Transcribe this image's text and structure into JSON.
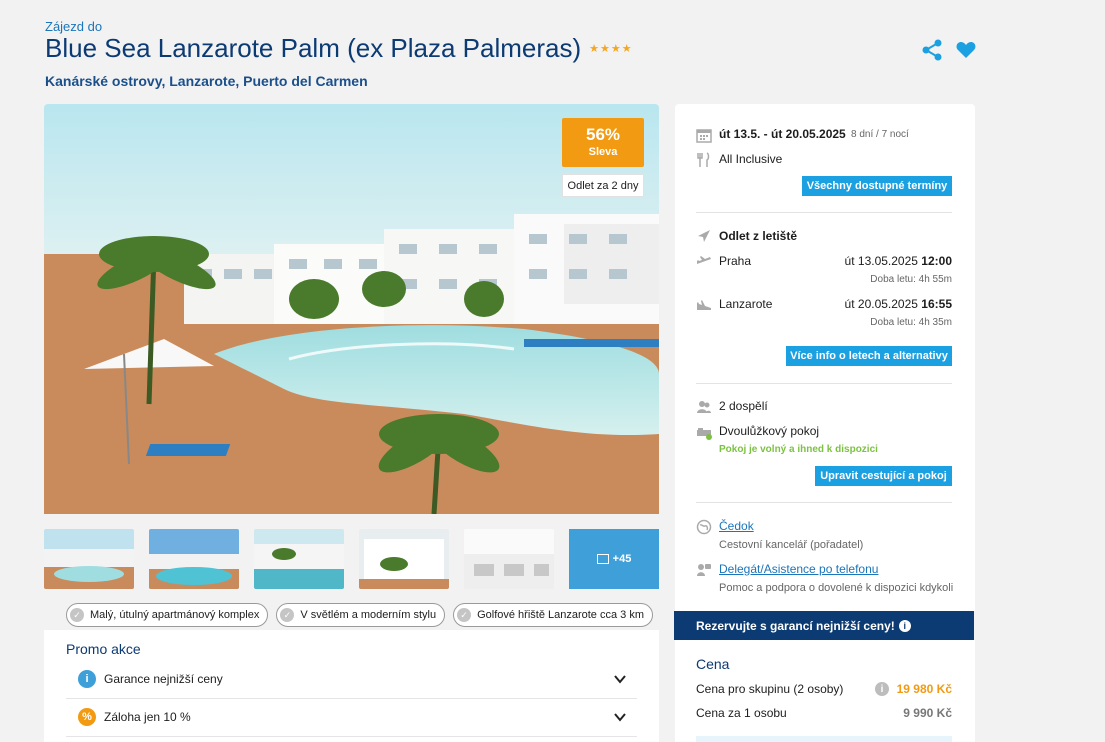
{
  "header": {
    "subtitle": "Zájezd do",
    "title": "Blue Sea Lanzarote Palm (ex Plaza Palmeras)",
    "stars": "★★★★",
    "location": "Kanárské ostrovy, Lanzarote, Puerto del Carmen"
  },
  "badges": {
    "discount_pct": "56%",
    "discount_label": "Sleva",
    "departure": "Odlet za 2 dny"
  },
  "gallery": {
    "more_label": "+45"
  },
  "features": [
    "Malý, útulný apartmánový komplex",
    "V světlém a moderním stylu",
    "Golfové hřiště Lanzarote cca 3 km"
  ],
  "promo": {
    "title": "Promo akce",
    "items": [
      {
        "label": "Garance nejnižší ceny",
        "icon": "info-icon",
        "color": "#3f9fd8"
      },
      {
        "label": "Záloha jen 10 %",
        "icon": "percent-icon",
        "color": "#f29a12"
      }
    ]
  },
  "sidebar": {
    "dates": "út 13.5. - út 20.05.2025",
    "duration": "8 dní / 7 nocí",
    "board": "All Inclusive",
    "all_dates_btn": "Všechny dostupné termíny",
    "flight_title": "Odlet z letiště",
    "outbound_city": "Praha",
    "outbound_date": "út 13.05.2025",
    "outbound_time": "12:00",
    "outbound_duration": "Doba letu: 4h 55m",
    "return_city": "Lanzarote",
    "return_date": "út 20.05.2025",
    "return_time": "16:55",
    "return_duration": "Doba letu: 4h 35m",
    "flights_btn": "Více info o letech a alternativy",
    "travellers": "2 dospělí",
    "room": "Dvoulůžkový pokoj",
    "room_status": "Pokoj je volný a ihned k dispozici",
    "edit_btn": "Upravit cestující a pokoj",
    "agency": "Čedok",
    "agency_desc": "Cestovní kancelář (pořadatel)",
    "support": "Delegát/Asistence po telefonu",
    "support_desc": "Pomoc a podpora o dovolené k dispozici kdykoli"
  },
  "reserve": {
    "label": "Rezervujte s garancí nejnižší ceny!"
  },
  "price": {
    "title": "Cena",
    "group_label": "Cena pro skupinu (2 osoby)",
    "group_value": "19 980 Kč",
    "person_label": "Cena za 1 osobu",
    "person_value": "9 990 Kč"
  },
  "colors": {
    "brand": "#0c3a73",
    "accent": "#1ba0e2",
    "discount": "#f29a12",
    "available": "#7cc242"
  }
}
